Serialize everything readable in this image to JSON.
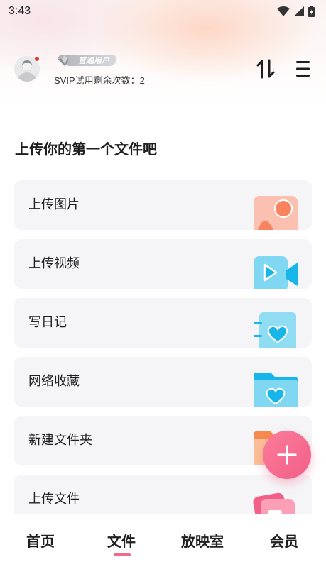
{
  "status_bar": {
    "time": "3:43"
  },
  "header": {
    "user_badge": "普通用户",
    "svip_text": "SVIP试用剩余次数：2"
  },
  "main": {
    "title": "上传你的第一个文件吧",
    "cards": [
      {
        "label": "上传图片",
        "icon": "image-icon"
      },
      {
        "label": "上传视频",
        "icon": "video-icon"
      },
      {
        "label": "写日记",
        "icon": "diary-icon"
      },
      {
        "label": "网络收藏",
        "icon": "favorite-folder-icon"
      },
      {
        "label": "新建文件夹",
        "icon": "folder-icon"
      },
      {
        "label": "上传文件",
        "icon": "file-icon"
      }
    ]
  },
  "bottom_nav": {
    "items": [
      "首页",
      "文件",
      "放映室",
      "会员"
    ],
    "active": "文件"
  },
  "colors": {
    "accent": "#f06a8e",
    "fab": "#f4668c",
    "card_bg": "#f5f5f7"
  }
}
